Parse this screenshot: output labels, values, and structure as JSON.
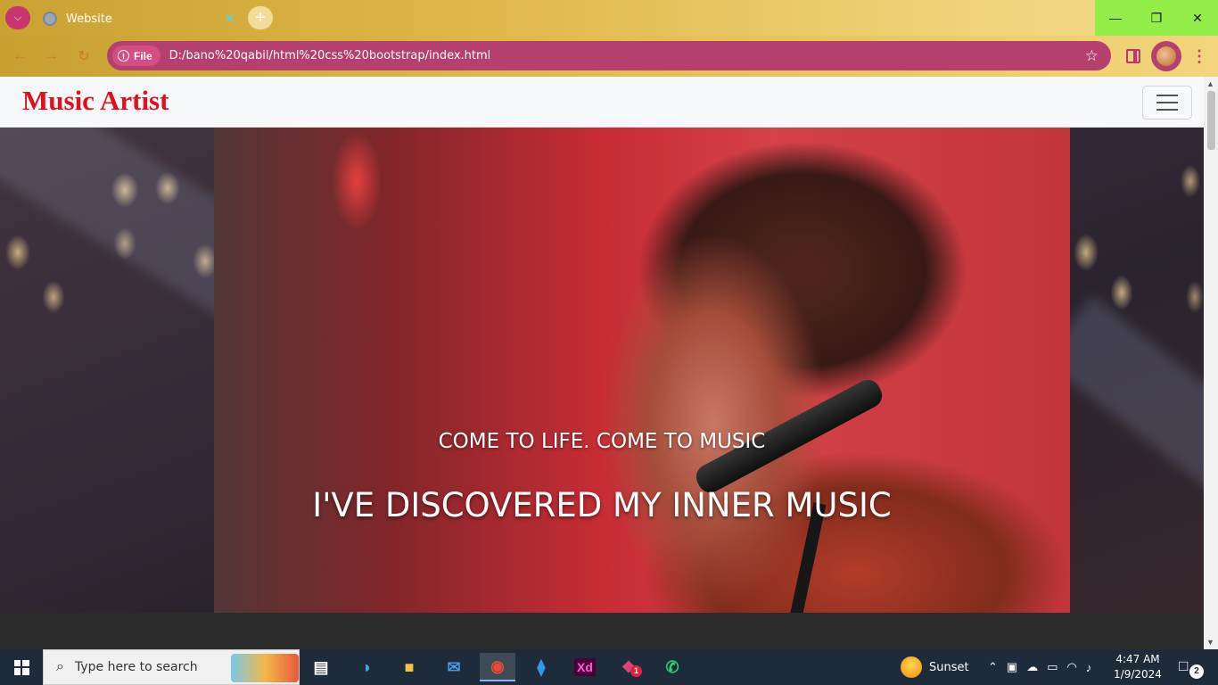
{
  "browser": {
    "tab": {
      "title": "Website"
    },
    "address_bar": {
      "chip_label": "File",
      "url": "D:/bano%20qabil/html%20css%20bootstrap/index.html"
    },
    "theme_color": "#e0b84a"
  },
  "page": {
    "navbar": {
      "brand": "Music Artist",
      "brand_color": "#e0101c"
    },
    "hero": {
      "subtitle": "COME TO LIFE. COME TO MUSIC",
      "title": "I'VE DISCOVERED MY INNER MUSIC"
    }
  },
  "taskbar": {
    "search_placeholder": "Type here to search",
    "pinned_apps": [
      "task-view",
      "edge",
      "file-explorer",
      "mail",
      "chrome",
      "vscode",
      "adobe-xd",
      "slack",
      "whatsapp"
    ],
    "weather": {
      "label": "Sunset"
    },
    "clock": {
      "time": "4:47 AM",
      "date": "1/9/2024"
    },
    "notifications_count": "2",
    "slack_badge": "1"
  }
}
